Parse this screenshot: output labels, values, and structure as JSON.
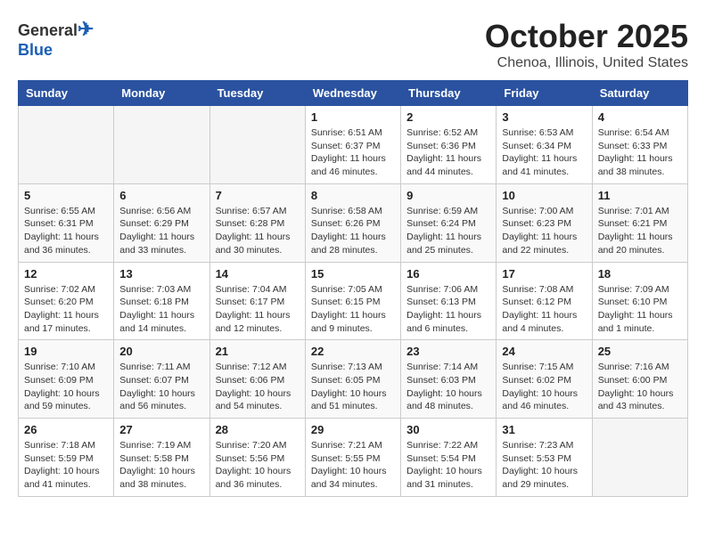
{
  "header": {
    "logo_line1": "General",
    "logo_line2": "Blue",
    "month_title": "October 2025",
    "location": "Chenoa, Illinois, United States"
  },
  "days_of_week": [
    "Sunday",
    "Monday",
    "Tuesday",
    "Wednesday",
    "Thursday",
    "Friday",
    "Saturday"
  ],
  "weeks": [
    [
      {
        "day": "",
        "info": ""
      },
      {
        "day": "",
        "info": ""
      },
      {
        "day": "",
        "info": ""
      },
      {
        "day": "1",
        "info": "Sunrise: 6:51 AM\nSunset: 6:37 PM\nDaylight: 11 hours\nand 46 minutes."
      },
      {
        "day": "2",
        "info": "Sunrise: 6:52 AM\nSunset: 6:36 PM\nDaylight: 11 hours\nand 44 minutes."
      },
      {
        "day": "3",
        "info": "Sunrise: 6:53 AM\nSunset: 6:34 PM\nDaylight: 11 hours\nand 41 minutes."
      },
      {
        "day": "4",
        "info": "Sunrise: 6:54 AM\nSunset: 6:33 PM\nDaylight: 11 hours\nand 38 minutes."
      }
    ],
    [
      {
        "day": "5",
        "info": "Sunrise: 6:55 AM\nSunset: 6:31 PM\nDaylight: 11 hours\nand 36 minutes."
      },
      {
        "day": "6",
        "info": "Sunrise: 6:56 AM\nSunset: 6:29 PM\nDaylight: 11 hours\nand 33 minutes."
      },
      {
        "day": "7",
        "info": "Sunrise: 6:57 AM\nSunset: 6:28 PM\nDaylight: 11 hours\nand 30 minutes."
      },
      {
        "day": "8",
        "info": "Sunrise: 6:58 AM\nSunset: 6:26 PM\nDaylight: 11 hours\nand 28 minutes."
      },
      {
        "day": "9",
        "info": "Sunrise: 6:59 AM\nSunset: 6:24 PM\nDaylight: 11 hours\nand 25 minutes."
      },
      {
        "day": "10",
        "info": "Sunrise: 7:00 AM\nSunset: 6:23 PM\nDaylight: 11 hours\nand 22 minutes."
      },
      {
        "day": "11",
        "info": "Sunrise: 7:01 AM\nSunset: 6:21 PM\nDaylight: 11 hours\nand 20 minutes."
      }
    ],
    [
      {
        "day": "12",
        "info": "Sunrise: 7:02 AM\nSunset: 6:20 PM\nDaylight: 11 hours\nand 17 minutes."
      },
      {
        "day": "13",
        "info": "Sunrise: 7:03 AM\nSunset: 6:18 PM\nDaylight: 11 hours\nand 14 minutes."
      },
      {
        "day": "14",
        "info": "Sunrise: 7:04 AM\nSunset: 6:17 PM\nDaylight: 11 hours\nand 12 minutes."
      },
      {
        "day": "15",
        "info": "Sunrise: 7:05 AM\nSunset: 6:15 PM\nDaylight: 11 hours\nand 9 minutes."
      },
      {
        "day": "16",
        "info": "Sunrise: 7:06 AM\nSunset: 6:13 PM\nDaylight: 11 hours\nand 6 minutes."
      },
      {
        "day": "17",
        "info": "Sunrise: 7:08 AM\nSunset: 6:12 PM\nDaylight: 11 hours\nand 4 minutes."
      },
      {
        "day": "18",
        "info": "Sunrise: 7:09 AM\nSunset: 6:10 PM\nDaylight: 11 hours\nand 1 minute."
      }
    ],
    [
      {
        "day": "19",
        "info": "Sunrise: 7:10 AM\nSunset: 6:09 PM\nDaylight: 10 hours\nand 59 minutes."
      },
      {
        "day": "20",
        "info": "Sunrise: 7:11 AM\nSunset: 6:07 PM\nDaylight: 10 hours\nand 56 minutes."
      },
      {
        "day": "21",
        "info": "Sunrise: 7:12 AM\nSunset: 6:06 PM\nDaylight: 10 hours\nand 54 minutes."
      },
      {
        "day": "22",
        "info": "Sunrise: 7:13 AM\nSunset: 6:05 PM\nDaylight: 10 hours\nand 51 minutes."
      },
      {
        "day": "23",
        "info": "Sunrise: 7:14 AM\nSunset: 6:03 PM\nDaylight: 10 hours\nand 48 minutes."
      },
      {
        "day": "24",
        "info": "Sunrise: 7:15 AM\nSunset: 6:02 PM\nDaylight: 10 hours\nand 46 minutes."
      },
      {
        "day": "25",
        "info": "Sunrise: 7:16 AM\nSunset: 6:00 PM\nDaylight: 10 hours\nand 43 minutes."
      }
    ],
    [
      {
        "day": "26",
        "info": "Sunrise: 7:18 AM\nSunset: 5:59 PM\nDaylight: 10 hours\nand 41 minutes."
      },
      {
        "day": "27",
        "info": "Sunrise: 7:19 AM\nSunset: 5:58 PM\nDaylight: 10 hours\nand 38 minutes."
      },
      {
        "day": "28",
        "info": "Sunrise: 7:20 AM\nSunset: 5:56 PM\nDaylight: 10 hours\nand 36 minutes."
      },
      {
        "day": "29",
        "info": "Sunrise: 7:21 AM\nSunset: 5:55 PM\nDaylight: 10 hours\nand 34 minutes."
      },
      {
        "day": "30",
        "info": "Sunrise: 7:22 AM\nSunset: 5:54 PM\nDaylight: 10 hours\nand 31 minutes."
      },
      {
        "day": "31",
        "info": "Sunrise: 7:23 AM\nSunset: 5:53 PM\nDaylight: 10 hours\nand 29 minutes."
      },
      {
        "day": "",
        "info": ""
      }
    ]
  ]
}
